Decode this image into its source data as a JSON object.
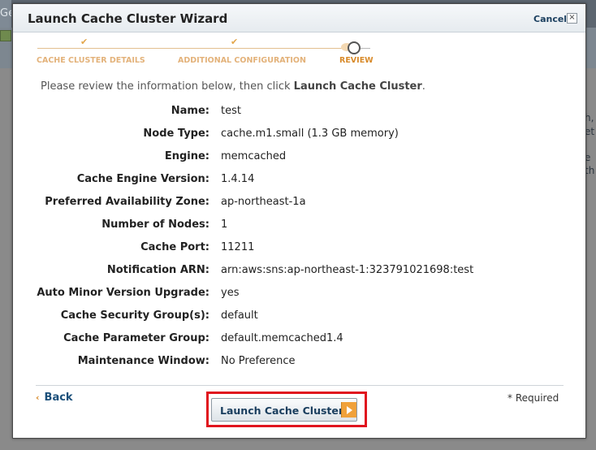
{
  "background": {
    "tab_fragment": "Ge",
    "right_fragments": [
      "h,",
      "et",
      "e",
      "th"
    ]
  },
  "wizard": {
    "title": "Launch Cache Cluster Wizard",
    "cancel_label": "Cancel",
    "close_glyph": "×",
    "steps": [
      {
        "label": "CACHE CLUSTER DETAILS",
        "state": "done"
      },
      {
        "label": "ADDITIONAL CONFIGURATION",
        "state": "done"
      },
      {
        "label": "REVIEW",
        "state": "current"
      }
    ],
    "check_glyph": "✔",
    "intro_prefix": "Please review the information below, then click ",
    "intro_action": "Launch Cache Cluster",
    "intro_suffix": ".",
    "fields": [
      {
        "label": "Name:",
        "value": "test"
      },
      {
        "label": "Node Type:",
        "value": "cache.m1.small (1.3 GB memory)"
      },
      {
        "label": "Engine:",
        "value": "memcached"
      },
      {
        "label": "Cache Engine Version:",
        "value": "1.4.14"
      },
      {
        "label": "Preferred Availability Zone:",
        "value": "ap-northeast-1a"
      },
      {
        "label": "Number of Nodes:",
        "value": "1"
      },
      {
        "label": "Cache Port:",
        "value": "11211"
      },
      {
        "label": "Notification ARN:",
        "value": "arn:aws:sns:ap-northeast-1:323791021698:test"
      },
      {
        "label": "Auto Minor Version Upgrade:",
        "value": "yes"
      },
      {
        "label": "Cache Security Group(s):",
        "value": "default"
      },
      {
        "label": "Cache Parameter Group:",
        "value": "default.memcached1.4"
      },
      {
        "label": "Maintenance Window:",
        "value": "No Preference"
      }
    ],
    "back_chevron": "‹",
    "back_label": "Back",
    "required_note": "* Required",
    "launch_label": "Launch Cache Cluster"
  },
  "colors": {
    "accent_orange": "#f0a13a",
    "highlight_red": "#e0141e",
    "link_blue": "#1a4f7a"
  }
}
